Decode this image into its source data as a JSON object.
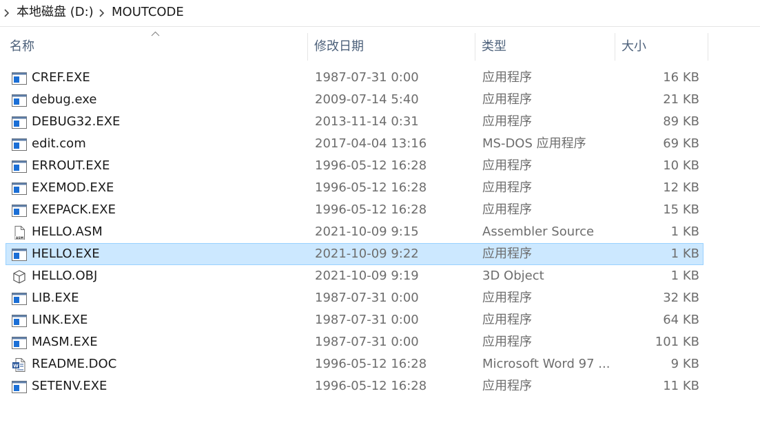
{
  "breadcrumb": {
    "drive": "本地磁盘 (D:)",
    "folder": "MOUTCODE"
  },
  "columns": {
    "name": "名称",
    "date": "修改日期",
    "type": "类型",
    "size": "大小",
    "sort": "name-ascending"
  },
  "colors": {
    "selection_bg": "#cce8ff",
    "selection_border": "#99d1ff",
    "header_text": "#4c607a",
    "secondary_text": "#6d6d6d"
  },
  "files": [
    {
      "name": "CREF.EXE",
      "date": "1987-07-31 0:00",
      "type": "应用程序",
      "size": "16 KB",
      "icon": "exe-icon"
    },
    {
      "name": "debug.exe",
      "date": "2009-07-14 5:40",
      "type": "应用程序",
      "size": "21 KB",
      "icon": "exe-icon"
    },
    {
      "name": "DEBUG32.EXE",
      "date": "2013-11-14 0:31",
      "type": "应用程序",
      "size": "89 KB",
      "icon": "exe-icon"
    },
    {
      "name": "edit.com",
      "date": "2017-04-04 13:16",
      "type": "MS-DOS 应用程序",
      "size": "69 KB",
      "icon": "exe-icon"
    },
    {
      "name": "ERROUT.EXE",
      "date": "1996-05-12 16:28",
      "type": "应用程序",
      "size": "10 KB",
      "icon": "exe-icon"
    },
    {
      "name": "EXEMOD.EXE",
      "date": "1996-05-12 16:28",
      "type": "应用程序",
      "size": "12 KB",
      "icon": "exe-icon"
    },
    {
      "name": "EXEPACK.EXE",
      "date": "1996-05-12 16:28",
      "type": "应用程序",
      "size": "15 KB",
      "icon": "exe-icon"
    },
    {
      "name": "HELLO.ASM",
      "date": "2021-10-09 9:15",
      "type": "Assembler Source",
      "size": "1 KB",
      "icon": "asm-file-icon"
    },
    {
      "name": "HELLO.EXE",
      "date": "2021-10-09 9:22",
      "type": "应用程序",
      "size": "1 KB",
      "icon": "exe-icon",
      "selected": true
    },
    {
      "name": "HELLO.OBJ",
      "date": "2021-10-09 9:19",
      "type": "3D Object",
      "size": "1 KB",
      "icon": "3d-object-icon"
    },
    {
      "name": "LIB.EXE",
      "date": "1987-07-31 0:00",
      "type": "应用程序",
      "size": "32 KB",
      "icon": "exe-icon"
    },
    {
      "name": "LINK.EXE",
      "date": "1987-07-31 0:00",
      "type": "应用程序",
      "size": "64 KB",
      "icon": "exe-icon"
    },
    {
      "name": "MASM.EXE",
      "date": "1987-07-31 0:00",
      "type": "应用程序",
      "size": "101 KB",
      "icon": "exe-icon"
    },
    {
      "name": "README.DOC",
      "date": "1996-05-12 16:28",
      "type": "Microsoft Word 97 ...",
      "size": "9 KB",
      "icon": "word-doc-icon"
    },
    {
      "name": "SETENV.EXE",
      "date": "1996-05-12 16:28",
      "type": "应用程序",
      "size": "11 KB",
      "icon": "exe-icon"
    }
  ]
}
